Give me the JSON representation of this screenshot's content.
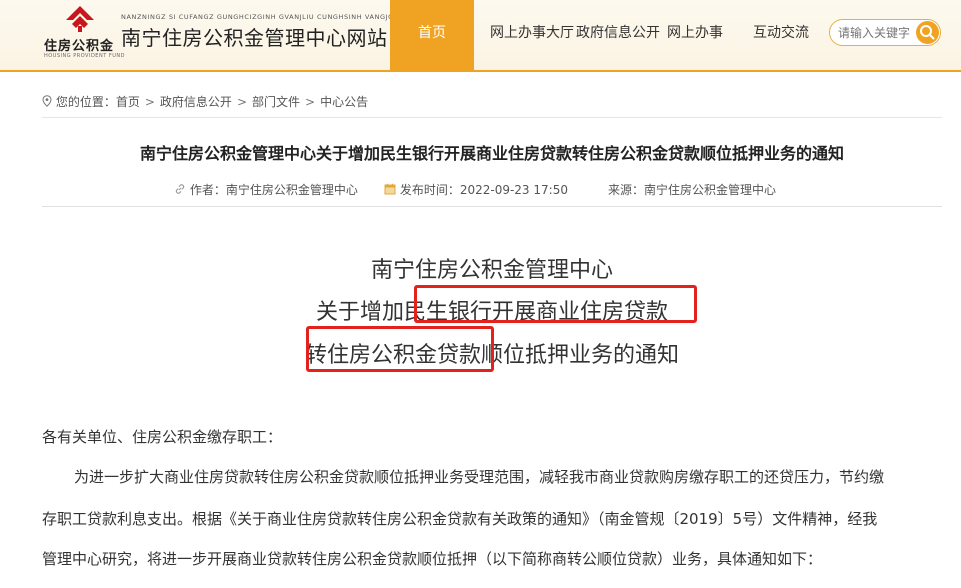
{
  "header": {
    "logo_text": "住房公积金",
    "logo_en": "HOUSING PROVIDENT FUND",
    "site_pinyin": "NANZNINGZ SI CUFANGZ GUNGHCIZGINH GVANJLIU CUNGHSINH VANGJCAN",
    "site_title": "南宁住房公积金管理中心网站",
    "nav": [
      {
        "label": "首页",
        "active": true
      },
      {
        "label": "网上办事大厅"
      },
      {
        "label": "政府信息公开"
      },
      {
        "label": "网上办事"
      },
      {
        "label": "互动交流"
      }
    ],
    "search": {
      "placeholder": "请输入关键字"
    }
  },
  "breadcrumb": {
    "prefix": "您的位置：",
    "items": [
      "首页",
      "政府信息公开",
      "部门文件",
      "中心公告"
    ]
  },
  "article": {
    "title": "南宁住房公积金管理中心关于增加民生银行开展商业住房贷款转住房公积金贷款顺位抵押业务的通知",
    "author": "作者：南宁住房公积金管理中心",
    "publish_time": "发布时间：2022-09-23 17:50",
    "source": "来源：南宁住房公积金管理中心",
    "heading": [
      "南宁住房公积金管理中心",
      "关于增加民生银行开展商业住房贷款",
      "转住房公积金贷款顺位抵押业务的通知"
    ],
    "salutation": "各有关单位、住房公积金缴存职工：",
    "body_lines": [
      "为进一步扩大商业住房贷款转住房公积金贷款顺位抵押业务受理范围，减轻我市商业贷款购房缴存职工的还贷压力，节约缴",
      "存职工贷款利息支出。根据《关于商业住房贷款转住房公积金贷款有关政策的通知》（南金管规〔2019〕5号）文件精神，经我",
      "管理中心研究，将进一步开展商业贷款转住房公积金贷款顺位抵押（以下简称商转公顺位贷款）业务，具体通知如下："
    ]
  },
  "colors": {
    "accent": "#f0a322",
    "highlight_box": "#e3211d",
    "logo_red": "#c8161d"
  }
}
